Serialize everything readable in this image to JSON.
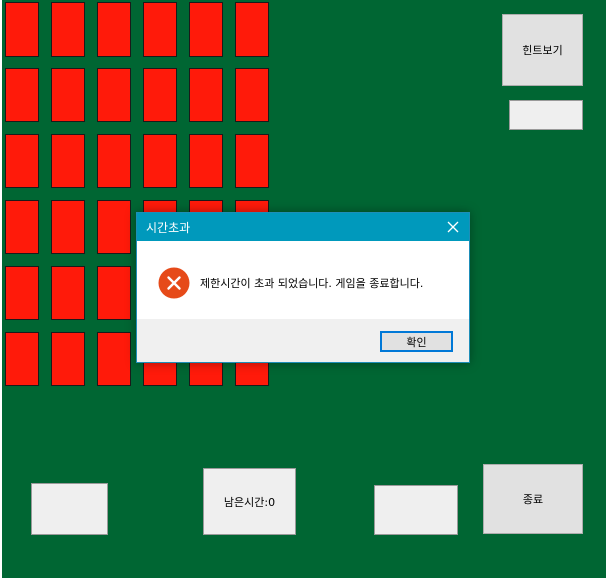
{
  "game": {
    "cards": {
      "columns": 6,
      "rows": 6
    },
    "hint_button_label": "힌트보기",
    "hint_box_value": "",
    "left_box_value": "",
    "time_remaining_label": "남은시간:0",
    "right_box_value": "",
    "quit_button_label": "종료"
  },
  "dialog": {
    "title": "시간초과",
    "message": "제한시간이 초과 되었습니다. 게임을 종료합니다.",
    "ok_label": "확인",
    "icon": "error-icon"
  },
  "colors": {
    "table_green": "#006633",
    "card_red": "#ff1a0a",
    "dialog_titlebar": "#0099bc",
    "error_icon": "#e64a19",
    "ok_focus_border": "#0078d7"
  }
}
